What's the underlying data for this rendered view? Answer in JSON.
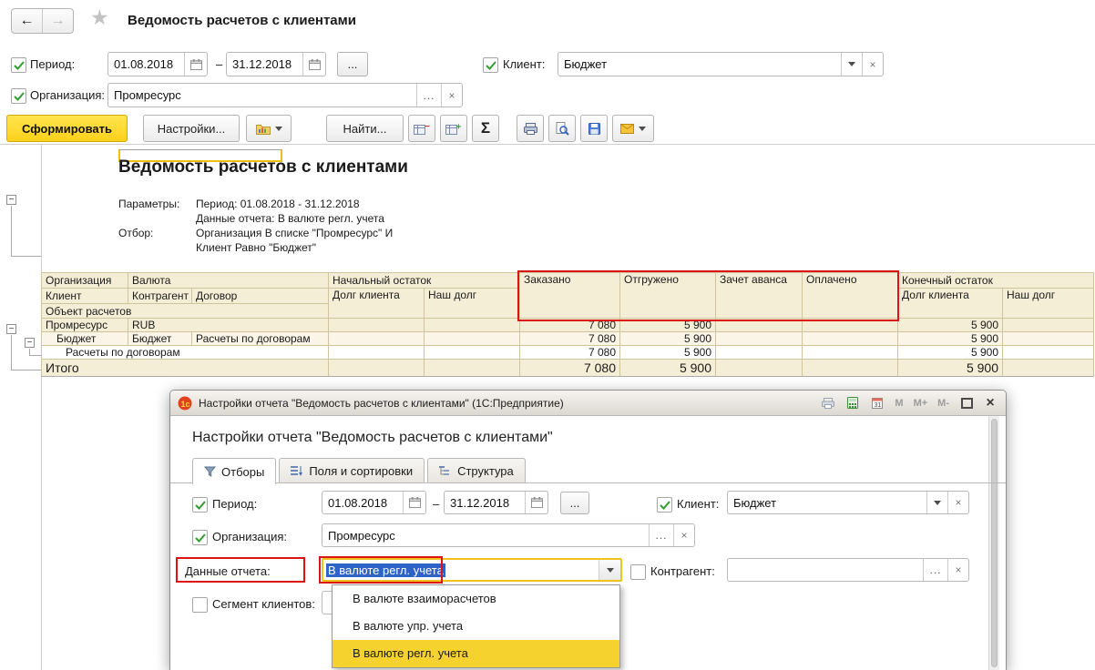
{
  "glyphs": {
    "back": "←",
    "forward": "→",
    "star": "★",
    "dash": "–",
    "dots": "...",
    "clear": "×",
    "minus": "−"
  },
  "colors": {
    "accent_yellow": "#fdd11a",
    "highlight_red": "#de1414",
    "selection_blue": "#2e64c8",
    "option_highlight": "#f5d22d",
    "table_header_bg": "#f5eed6"
  },
  "window": {
    "title": "Ведомость расчетов с клиентами"
  },
  "filters": {
    "period": {
      "label": "Период:",
      "from": "01.08.2018",
      "to": "31.12.2018"
    },
    "organization": {
      "label": "Организация:",
      "value": "Промресурс"
    },
    "client": {
      "label": "Клиент:",
      "value": "Бюджет"
    }
  },
  "toolbar": {
    "generate": "Сформировать",
    "settings": "Настройки...",
    "find": "Найти...",
    "sum": "Σ"
  },
  "report": {
    "title": "Ведомость расчетов с клиентами",
    "parameters_label": "Параметры:",
    "parameters": [
      "Период: 01.08.2018 - 31.12.2018",
      "Данные отчета: В валюте регл. учета"
    ],
    "filter_label": "Отбор:",
    "filter_lines": [
      "Организация В списке \"Промресурс\" И",
      "Клиент Равно \"Бюджет\""
    ],
    "table": {
      "headers": {
        "org": "Организация",
        "currency": "Валюта",
        "opening": "Начальный остаток",
        "ordered": "Заказано",
        "shipped": "Отгружено",
        "advance": "Зачет аванса",
        "paid": "Оплачено",
        "closing": "Конечный остаток",
        "client": "Клиент",
        "counterparty": "Контрагент",
        "contract": "Договор",
        "client_debt": "Долг клиента",
        "our_debt": "Наш долг",
        "object": "Объект расчетов"
      },
      "rows": {
        "org_row": {
          "name": "Промресурс",
          "currency": "RUB",
          "ordered": "7 080",
          "shipped": "5 900",
          "closing_client_debt": "5 900"
        },
        "client_row": {
          "name": "Бюджет",
          "counterparty": "Бюджет",
          "contract": "Расчеты по договорам",
          "ordered": "7 080",
          "shipped": "5 900",
          "closing_client_debt": "5 900"
        },
        "object_row": {
          "name": "Расчеты по договорам",
          "ordered": "7 080",
          "shipped": "5 900",
          "closing_client_debt": "5 900"
        },
        "total_row": {
          "name": "Итого",
          "ordered": "7 080",
          "shipped": "5 900",
          "closing_client_debt": "5 900"
        }
      }
    }
  },
  "dialog": {
    "title": "Настройки отчета \"Ведомость расчетов с клиентами\"  (1С:Предприятие)",
    "logo": "1с",
    "memory": {
      "m": "M",
      "m_plus": "M+",
      "m_minus": "M-"
    },
    "heading": "Настройки отчета \"Ведомость расчетов с клиентами\"",
    "tabs": {
      "filters": "Отборы",
      "fields": "Поля и сортировки",
      "structure": "Структура"
    },
    "period": {
      "label": "Период:",
      "from": "01.08.2018",
      "to": "31.12.2018"
    },
    "organization": {
      "label": "Организация:",
      "value": "Промресурс"
    },
    "client": {
      "label": "Клиент:",
      "value": "Бюджет"
    },
    "report_data": {
      "label": "Данные отчета:",
      "value": "В валюте регл. учета"
    },
    "counterparty": {
      "label": "Контрагент:",
      "value": ""
    },
    "segment": {
      "label": "Сегмент клиентов:"
    },
    "dropdown": {
      "options": [
        "В валюте взаиморасчетов",
        "В валюте упр. учета",
        "В валюте регл. учета"
      ],
      "highlighted": "В валюте регл. учета"
    }
  }
}
